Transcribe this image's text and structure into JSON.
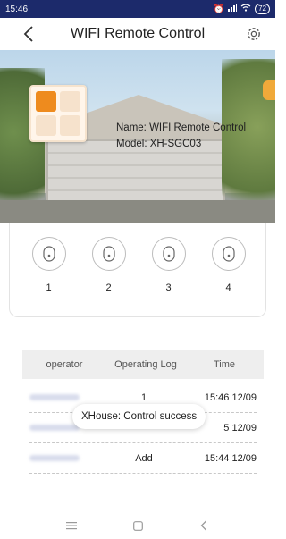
{
  "status_bar": {
    "time": "15:46",
    "icons": [
      "alarm-icon",
      "signal-icon",
      "wifi-icon"
    ],
    "battery": "72"
  },
  "header": {
    "title": "WIFI Remote Control",
    "back_icon": "chevron-left-icon",
    "settings_icon": "gear-icon"
  },
  "device": {
    "name_line": "Name: WIFI Remote Control",
    "model_line": "Model: XH-SGC03",
    "grid_on": [
      true,
      false,
      false,
      false
    ],
    "accent": "#ee8b1e"
  },
  "buttons": [
    {
      "label": "1"
    },
    {
      "label": "2"
    },
    {
      "label": "3"
    },
    {
      "label": "4"
    }
  ],
  "log": {
    "columns": [
      "operator",
      "Operating Log",
      "Time"
    ],
    "rows": [
      {
        "log": "1",
        "time": "15:46 12/09"
      },
      {
        "log": "",
        "time": "5 12/09"
      },
      {
        "log": "Add",
        "time": "15:44 12/09"
      }
    ]
  },
  "toast": "XHouse: Control success",
  "nav_bar": [
    "menu-icon",
    "home-icon",
    "back-icon"
  ]
}
